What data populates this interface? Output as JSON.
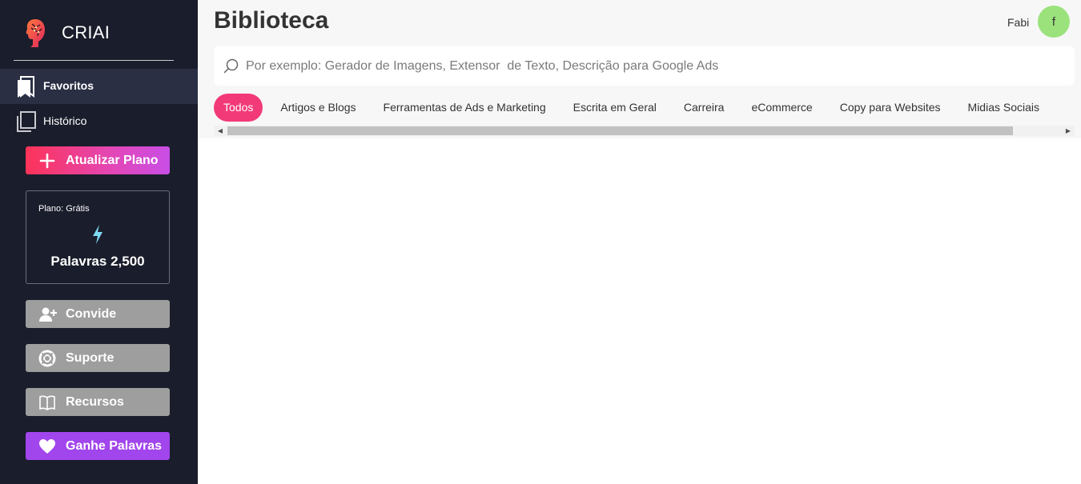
{
  "brand": {
    "name": "CRIAI",
    "logo_icon": "human-head-logo-icon"
  },
  "sidebar": {
    "nav": [
      {
        "label": "Favoritos",
        "icon": "bookmark-icon",
        "active": true
      },
      {
        "label": "Histórico",
        "icon": "copy-pages-icon",
        "active": false
      }
    ],
    "upgrade_button": {
      "label": "Atualizar Plano",
      "icon": "plus-icon"
    },
    "plan": {
      "name": "Plano: Grátis",
      "icon": "lightning-bolt-icon",
      "words": "Palavras 2,500"
    },
    "buttons": [
      {
        "label": "Convide",
        "icon": "user-plus-icon"
      },
      {
        "label": "Suporte",
        "icon": "lifebuoy-icon"
      },
      {
        "label": "Recursos",
        "icon": "book-open-icon"
      }
    ],
    "earn_button": {
      "label": "Ganhe Palavras",
      "icon": "heart-icon"
    }
  },
  "header": {
    "title": "Biblioteca",
    "user": {
      "name": "Fabi",
      "avatar_letter": "f"
    }
  },
  "search": {
    "placeholder": "Por exemplo: Gerador de Imagens, Extensor  de Texto, Descrição para Google Ads",
    "value": ""
  },
  "tabs": [
    {
      "label": "Todos",
      "active": true
    },
    {
      "label": "Artigos e Blogs"
    },
    {
      "label": "Ferramentas de Ads e Marketing"
    },
    {
      "label": "Escrita em Geral"
    },
    {
      "label": "Carreira"
    },
    {
      "label": "eCommerce"
    },
    {
      "label": "Copy para Websites"
    },
    {
      "label": "Midias Sociais"
    }
  ],
  "colors": {
    "sidebar_bg": "#1a1d2b",
    "active_nav_bg": "#2b2f44",
    "tab_active": "#f23a78",
    "upgrade_gradient_start": "#fc3358",
    "upgrade_gradient_end": "#c84ee6",
    "earn_button": "#a145ec",
    "gray_button": "#9e9e9e",
    "avatar_bg": "#9be27c",
    "bolt": "#7fd9f0"
  }
}
